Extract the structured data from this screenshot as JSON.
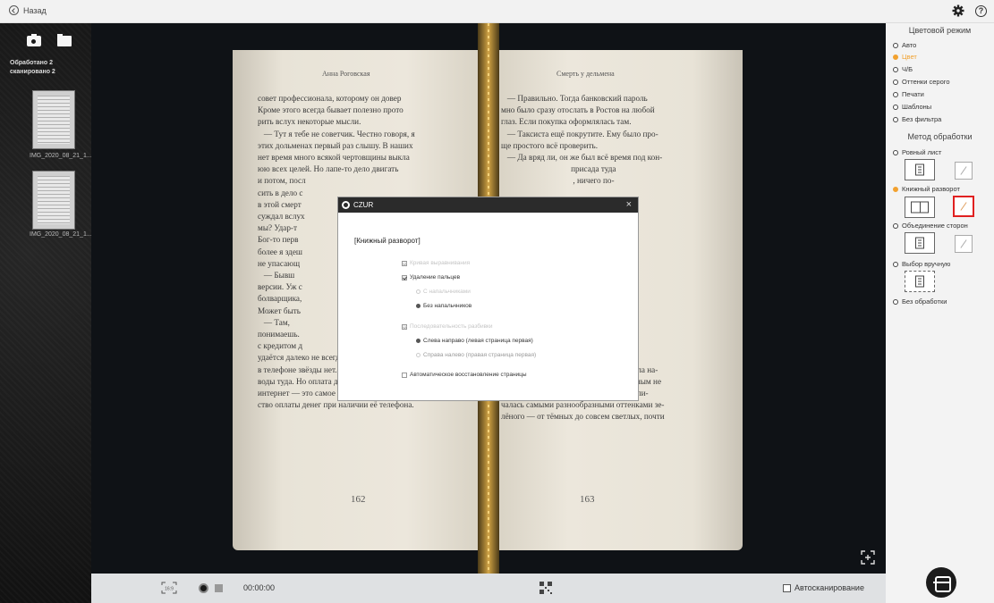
{
  "topbar": {
    "back_label": "Назад"
  },
  "sidebar": {
    "processed_label": "Обработано 2",
    "scanned_label": "сканировано 2",
    "thumbnails": [
      {
        "label": "IMG_2020_08_21_1..."
      },
      {
        "label": "IMG_2020_08_21_1..."
      }
    ]
  },
  "book": {
    "left_header": "Анна Роговская",
    "right_header": "Смерть у дельмена",
    "left_text": "совет профессионала, которому он довер\nКроме этого всегда бывает полезно прото\nрить вслух некоторые мысли.\n   — Тут я тебе не советчик. Честно говоря, я\nэтих дольменах первый раз слышу. В наших\nнет время много всякой чертовщины выкла\nюю всех целей. Но лапе-то дело двигать\nи потом, посл\nсить в дело с\nв этой смерт\nсуждал вслух\nмы? Удар-т\nБог-то перв\nболее я здеш\nне упасающ\n   — Бывш\nверсии. Уж с\nболварщика,\nМожет быть\n   — Там,\nпонимаешь.\nс кредитом д\nудаётся далеко не всегда. Если, конечно, н\nв телефоне звёзды нет. Многие записыва\nводы туда. Но оплата дорогой покупки чер\nинтернет — это самое простое и надёжное ср\nство оплаты денег при наличии её телефона.",
    "right_text": "   — Правильно. Тогда банковский пароль\nмно было сразу отослать в Ростов на любой\nглаз. Если покупка оформлялась там.\n   — Таксиста ещё покрутите. Ему было про-\nще простого всё проверить.\n   — Да вряд ли, он же был всё время под кон-\n                                  присада туда\n                                   , ничего по-\n\n                            ри попойной.\n\n                            На проводе\n\n                          ася. — Заб-\n                           ри радостный\n                           много здоро-\n\n\n\n\n\n                           следующий\nных квартал сопкомаме, но не вар-\nий. Уникальная сочинская природа сияла на-\nтуральными красками. Море было видным не\nпром, а ярко-синим. Растительность отли-\nчалась самыми разнообразными оттенками зе-\nлёного — от тёмных до совсем светлых, почти",
    "left_page_number": "162",
    "right_page_number": "163"
  },
  "bottombar": {
    "timer": "00:00:00",
    "autoscan_label": "Автосканирование"
  },
  "rpanel": {
    "color_mode_title": "Цветовой режим",
    "color_modes": [
      {
        "label": "Авто",
        "selected": false
      },
      {
        "label": "Цвет",
        "selected": true
      },
      {
        "label": "Ч/Б",
        "selected": false
      },
      {
        "label": "Оттенки серого",
        "selected": false
      },
      {
        "label": "Печати",
        "selected": false
      },
      {
        "label": "Шаблоны",
        "selected": false
      },
      {
        "label": "Без фильтра",
        "selected": false
      }
    ],
    "processing_title": "Метод обработки",
    "processing_modes": [
      {
        "label": "Ровный лист",
        "selected": false
      },
      {
        "label": "Книжный разворот",
        "selected": true
      },
      {
        "label": "Объединение сторон",
        "selected": false
      },
      {
        "label": "Выбор вручную",
        "selected": false
      },
      {
        "label": "Без обработки",
        "selected": false
      }
    ],
    "accent_color": "#f2a12e",
    "highlight_color": "#e02020"
  },
  "modal": {
    "app_name": "CZUR",
    "close_glyph": "×",
    "heading": "[Книжный разворот]",
    "options": {
      "curve_correction": "Кривая выравнивания",
      "finger_removal": "Удаление пальцев",
      "with_fingertips": "С напальчниками",
      "without_fingertips": "Без напальчников",
      "page_order": "Последовательность разбивки",
      "left_to_right": "Слева направо (левая страница первая)",
      "right_to_left": "Справа налево (правая страница первая)",
      "auto_restore": "Автоматическое восстановление страницы"
    }
  }
}
